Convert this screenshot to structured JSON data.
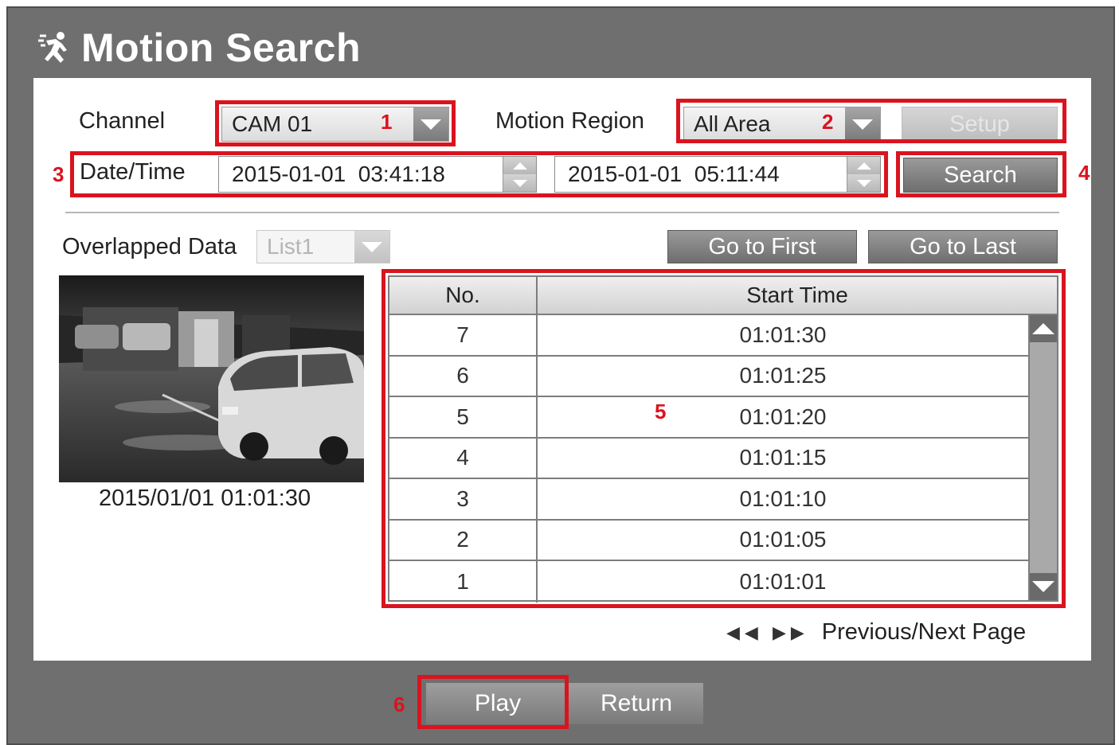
{
  "window": {
    "title": "Motion Search"
  },
  "controls": {
    "channel_label": "Channel",
    "channel_value": "CAM 01",
    "motion_region_label": "Motion Region",
    "motion_region_value": "All Area",
    "setup_label": "Setup",
    "datetime_label": "Date/Time",
    "start_datetime": "2015-01-01  03:41:18",
    "end_datetime": "2015-01-01  05:11:44",
    "search_label": "Search",
    "overlapped_label": "Overlapped Data",
    "overlapped_value": "List1",
    "go_first_label": "Go to First",
    "go_last_label": "Go to Last"
  },
  "preview": {
    "timestamp": "2015/01/01  01:01:30"
  },
  "table": {
    "headers": [
      "No.",
      "Start Time"
    ],
    "rows": [
      {
        "no": "7",
        "time": "01:01:30"
      },
      {
        "no": "6",
        "time": "01:01:25"
      },
      {
        "no": "5",
        "time": "01:01:20"
      },
      {
        "no": "4",
        "time": "01:01:15"
      },
      {
        "no": "3",
        "time": "01:01:10"
      },
      {
        "no": "2",
        "time": "01:01:05"
      },
      {
        "no": "1",
        "time": "01:01:01"
      }
    ]
  },
  "pager": {
    "icons": "◀◀ ▶▶",
    "label": "Previous/Next Page"
  },
  "footer": {
    "play_label": "Play",
    "return_label": "Return"
  },
  "annotations": {
    "m1": "1",
    "m2": "2",
    "m3": "3",
    "m4": "4",
    "m5": "5",
    "m6": "6",
    "color": "#d9141f"
  }
}
